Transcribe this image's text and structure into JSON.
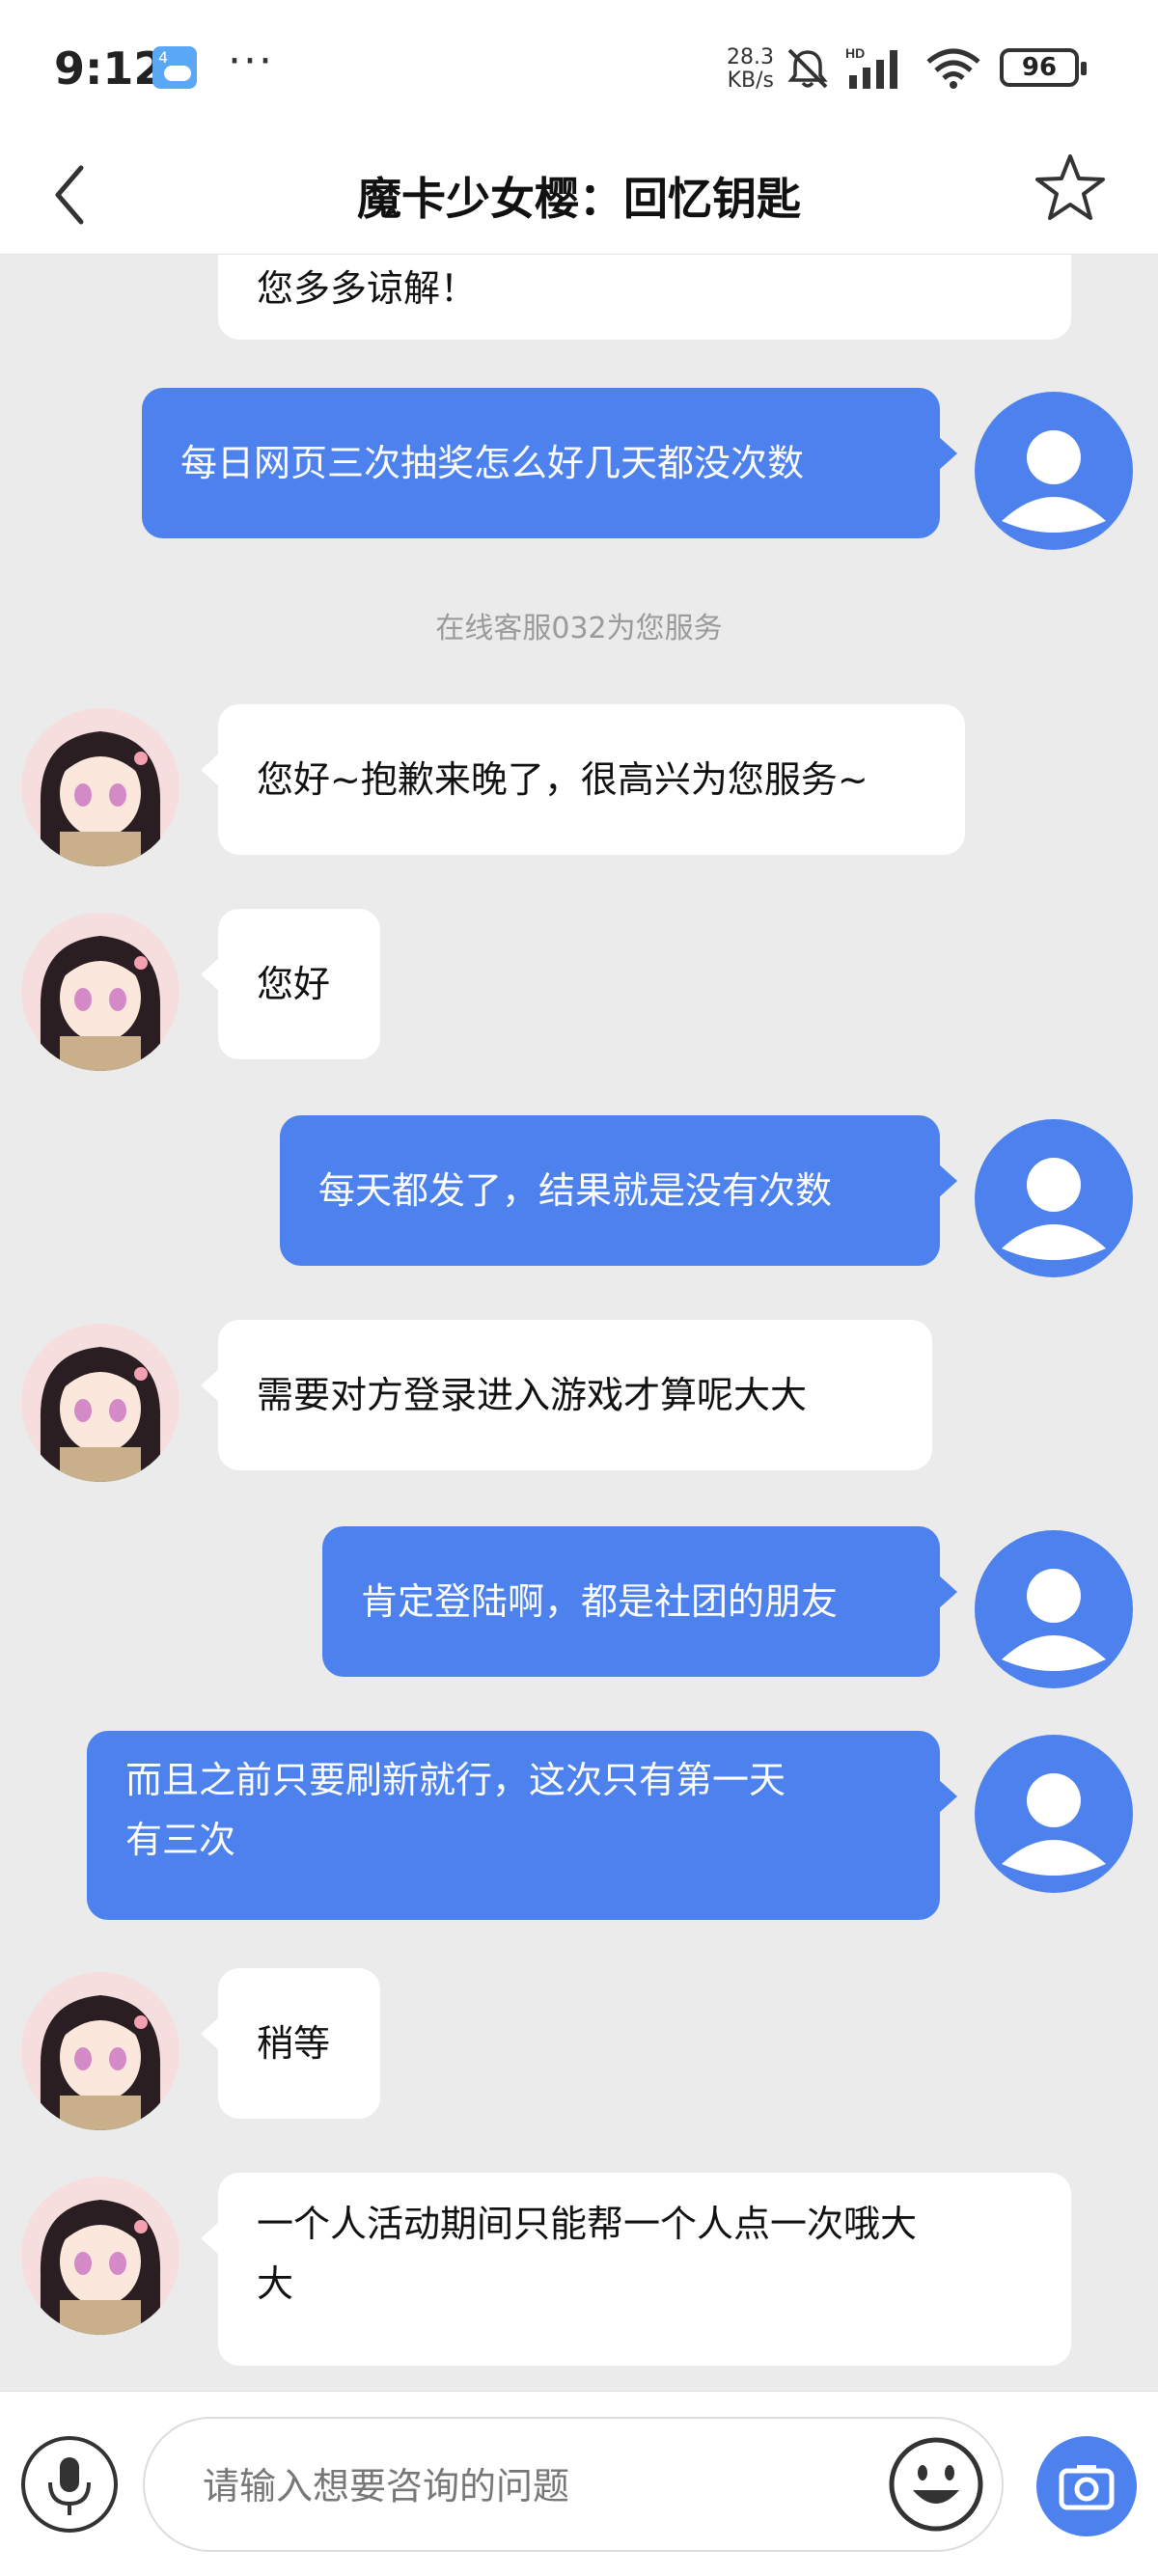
{
  "status_bar": {
    "time": "9:12",
    "weather_badge": "4",
    "more": "···",
    "net_speed_value": "28.3",
    "net_speed_unit": "KB/s",
    "signal_label": "HD",
    "battery": "96"
  },
  "header": {
    "title": "魔卡少女樱：回忆钥匙",
    "back_icon": "chevron-left-icon",
    "star_icon": "star-outline-icon"
  },
  "messages": [
    {
      "side": "in",
      "text": "您多多谅解！"
    },
    {
      "side": "out",
      "text": "每日网页三次抽奖怎么好几天都没次数"
    },
    {
      "system": "在线客服032为您服务"
    },
    {
      "side": "in",
      "text": "您好~抱歉来晚了，很高兴为您服务~"
    },
    {
      "side": "in",
      "text": "您好"
    },
    {
      "side": "out",
      "text": "每天都发了，结果就是没有次数"
    },
    {
      "side": "in",
      "text": "需要对方登录进入游戏才算呢大大"
    },
    {
      "side": "out",
      "text": "肯定登陆啊，都是社团的朋友"
    },
    {
      "side": "out",
      "line1": "而且之前只要刷新就行，这次只有第一天",
      "line2": "有三次"
    },
    {
      "side": "in",
      "text": "稍等"
    },
    {
      "side": "in",
      "line1": "一个人活动期间只能帮一个人点一次哦大",
      "line2": "大"
    }
  ],
  "input": {
    "placeholder": "请输入想要咨询的问题"
  },
  "colors": {
    "accent": "#4d82ee",
    "background": "#ebebeb",
    "bubble_in": "#ffffff"
  }
}
